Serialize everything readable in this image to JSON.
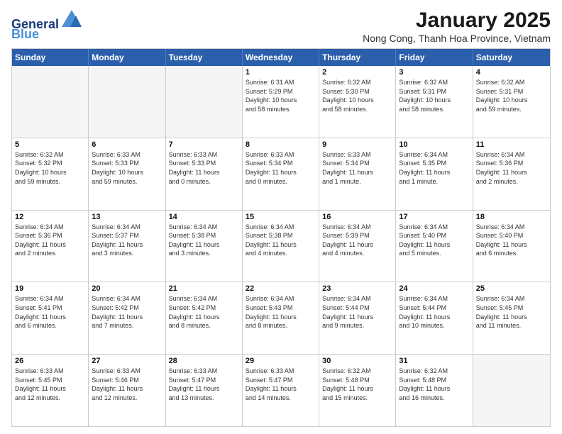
{
  "header": {
    "logo_line1": "General",
    "logo_line2": "Blue",
    "month_title": "January 2025",
    "subtitle": "Nong Cong, Thanh Hoa Province, Vietnam"
  },
  "day_headers": [
    "Sunday",
    "Monday",
    "Tuesday",
    "Wednesday",
    "Thursday",
    "Friday",
    "Saturday"
  ],
  "weeks": [
    [
      {
        "num": "",
        "info": "",
        "empty": true
      },
      {
        "num": "",
        "info": "",
        "empty": true
      },
      {
        "num": "",
        "info": "",
        "empty": true
      },
      {
        "num": "1",
        "info": "Sunrise: 6:31 AM\nSunset: 5:29 PM\nDaylight: 10 hours\nand 58 minutes.",
        "empty": false
      },
      {
        "num": "2",
        "info": "Sunrise: 6:32 AM\nSunset: 5:30 PM\nDaylight: 10 hours\nand 58 minutes.",
        "empty": false
      },
      {
        "num": "3",
        "info": "Sunrise: 6:32 AM\nSunset: 5:31 PM\nDaylight: 10 hours\nand 58 minutes.",
        "empty": false
      },
      {
        "num": "4",
        "info": "Sunrise: 6:32 AM\nSunset: 5:31 PM\nDaylight: 10 hours\nand 59 minutes.",
        "empty": false
      }
    ],
    [
      {
        "num": "5",
        "info": "Sunrise: 6:32 AM\nSunset: 5:32 PM\nDaylight: 10 hours\nand 59 minutes.",
        "empty": false
      },
      {
        "num": "6",
        "info": "Sunrise: 6:33 AM\nSunset: 5:33 PM\nDaylight: 10 hours\nand 59 minutes.",
        "empty": false
      },
      {
        "num": "7",
        "info": "Sunrise: 6:33 AM\nSunset: 5:33 PM\nDaylight: 11 hours\nand 0 minutes.",
        "empty": false
      },
      {
        "num": "8",
        "info": "Sunrise: 6:33 AM\nSunset: 5:34 PM\nDaylight: 11 hours\nand 0 minutes.",
        "empty": false
      },
      {
        "num": "9",
        "info": "Sunrise: 6:33 AM\nSunset: 5:34 PM\nDaylight: 11 hours\nand 1 minute.",
        "empty": false
      },
      {
        "num": "10",
        "info": "Sunrise: 6:34 AM\nSunset: 5:35 PM\nDaylight: 11 hours\nand 1 minute.",
        "empty": false
      },
      {
        "num": "11",
        "info": "Sunrise: 6:34 AM\nSunset: 5:36 PM\nDaylight: 11 hours\nand 2 minutes.",
        "empty": false
      }
    ],
    [
      {
        "num": "12",
        "info": "Sunrise: 6:34 AM\nSunset: 5:36 PM\nDaylight: 11 hours\nand 2 minutes.",
        "empty": false
      },
      {
        "num": "13",
        "info": "Sunrise: 6:34 AM\nSunset: 5:37 PM\nDaylight: 11 hours\nand 3 minutes.",
        "empty": false
      },
      {
        "num": "14",
        "info": "Sunrise: 6:34 AM\nSunset: 5:38 PM\nDaylight: 11 hours\nand 3 minutes.",
        "empty": false
      },
      {
        "num": "15",
        "info": "Sunrise: 6:34 AM\nSunset: 5:38 PM\nDaylight: 11 hours\nand 4 minutes.",
        "empty": false
      },
      {
        "num": "16",
        "info": "Sunrise: 6:34 AM\nSunset: 5:39 PM\nDaylight: 11 hours\nand 4 minutes.",
        "empty": false
      },
      {
        "num": "17",
        "info": "Sunrise: 6:34 AM\nSunset: 5:40 PM\nDaylight: 11 hours\nand 5 minutes.",
        "empty": false
      },
      {
        "num": "18",
        "info": "Sunrise: 6:34 AM\nSunset: 5:40 PM\nDaylight: 11 hours\nand 6 minutes.",
        "empty": false
      }
    ],
    [
      {
        "num": "19",
        "info": "Sunrise: 6:34 AM\nSunset: 5:41 PM\nDaylight: 11 hours\nand 6 minutes.",
        "empty": false
      },
      {
        "num": "20",
        "info": "Sunrise: 6:34 AM\nSunset: 5:42 PM\nDaylight: 11 hours\nand 7 minutes.",
        "empty": false
      },
      {
        "num": "21",
        "info": "Sunrise: 6:34 AM\nSunset: 5:42 PM\nDaylight: 11 hours\nand 8 minutes.",
        "empty": false
      },
      {
        "num": "22",
        "info": "Sunrise: 6:34 AM\nSunset: 5:43 PM\nDaylight: 11 hours\nand 8 minutes.",
        "empty": false
      },
      {
        "num": "23",
        "info": "Sunrise: 6:34 AM\nSunset: 5:44 PM\nDaylight: 11 hours\nand 9 minutes.",
        "empty": false
      },
      {
        "num": "24",
        "info": "Sunrise: 6:34 AM\nSunset: 5:44 PM\nDaylight: 11 hours\nand 10 minutes.",
        "empty": false
      },
      {
        "num": "25",
        "info": "Sunrise: 6:34 AM\nSunset: 5:45 PM\nDaylight: 11 hours\nand 11 minutes.",
        "empty": false
      }
    ],
    [
      {
        "num": "26",
        "info": "Sunrise: 6:33 AM\nSunset: 5:45 PM\nDaylight: 11 hours\nand 12 minutes.",
        "empty": false
      },
      {
        "num": "27",
        "info": "Sunrise: 6:33 AM\nSunset: 5:46 PM\nDaylight: 11 hours\nand 12 minutes.",
        "empty": false
      },
      {
        "num": "28",
        "info": "Sunrise: 6:33 AM\nSunset: 5:47 PM\nDaylight: 11 hours\nand 13 minutes.",
        "empty": false
      },
      {
        "num": "29",
        "info": "Sunrise: 6:33 AM\nSunset: 5:47 PM\nDaylight: 11 hours\nand 14 minutes.",
        "empty": false
      },
      {
        "num": "30",
        "info": "Sunrise: 6:32 AM\nSunset: 5:48 PM\nDaylight: 11 hours\nand 15 minutes.",
        "empty": false
      },
      {
        "num": "31",
        "info": "Sunrise: 6:32 AM\nSunset: 5:48 PM\nDaylight: 11 hours\nand 16 minutes.",
        "empty": false
      },
      {
        "num": "",
        "info": "",
        "empty": true
      }
    ]
  ]
}
